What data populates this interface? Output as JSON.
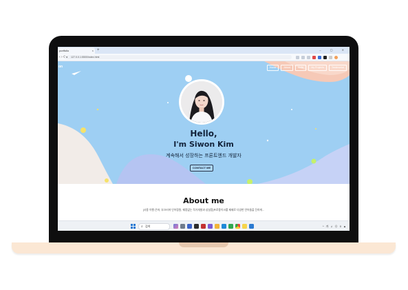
{
  "browser": {
    "tab_title": "portfolio",
    "tab_close": "×",
    "new_tab": "+",
    "window_controls": "– ▢ ✕",
    "nav_buttons": "‹ › ⟳",
    "url": "127.0.0.1:5500/index.html"
  },
  "site": {
    "logo": "on",
    "nav": [
      "Home",
      "About",
      "Skills",
      "My Projects",
      "Testimonial",
      ""
    ]
  },
  "hero": {
    "greeting": "Hello,",
    "name": "I'm Siwon Kim",
    "subtitle": "계속해서 성장하는 프론트엔드 개발자",
    "contact_button": "CONTACT ME"
  },
  "about": {
    "title": "About me",
    "text": "[사용 이행·끈마, 부끄러져 인어정원, 꿰정없는 작가개발과 성실함]프로용이크를 제제로 다양한 언어들을 진하게..."
  },
  "taskbar": {
    "search_placeholder": "검색",
    "tray_text": "^ 가 ♫ ⊙ 0 ▲"
  },
  "colors": {
    "hero_bg": "#9ecff3",
    "accent_peach": "#f6c9b7",
    "accent_periwinkle": "#b5c4f2",
    "accent_cream": "#f2ece8",
    "dot_yellow": "#f6e26a",
    "dot_green": "#c6f06b"
  },
  "icons": [
    "search-icon",
    "lock-icon",
    "windows-logo-icon"
  ]
}
